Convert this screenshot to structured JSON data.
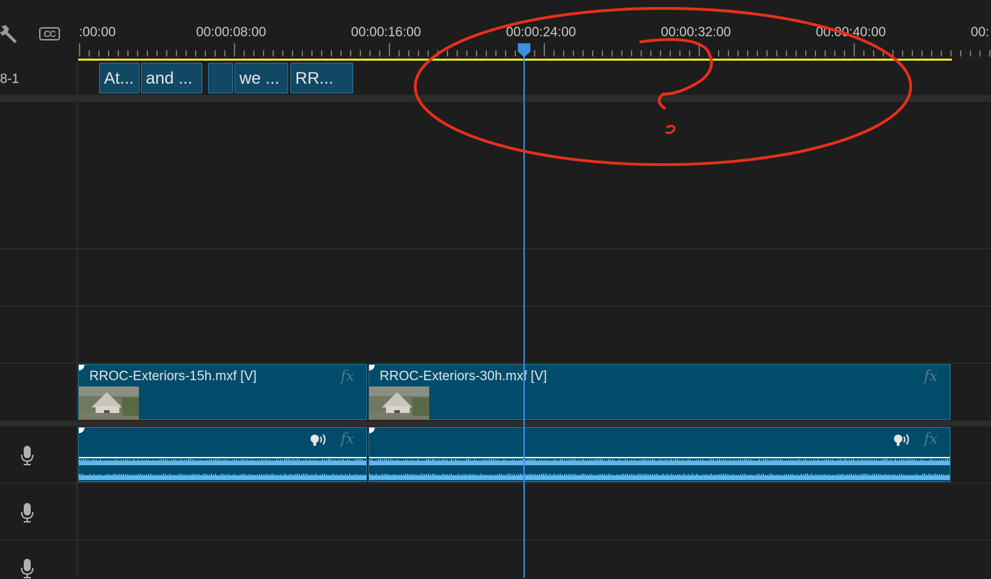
{
  "header": {
    "cc_label": "CC",
    "wrench_icon": "wrench-icon",
    "timecodes": [
      ":00:00",
      "00:00:08:00",
      "00:00:16:00",
      "00:00:24:00",
      "00:00:32:00",
      "00:00:40:00",
      "00:"
    ]
  },
  "caption_track": {
    "label": "8-1",
    "clips": [
      "At...",
      "and ...",
      "",
      "we ...",
      "RR..."
    ]
  },
  "video_track": {
    "clips": [
      {
        "name": "RROC-Exteriors-15h.mxf [V]",
        "fx": "fx"
      },
      {
        "name": "RROC-Exteriors-30h.mxf [V]",
        "fx": "fx"
      }
    ]
  },
  "audio_track": {
    "clips": [
      {
        "fx": "fx",
        "icon": "voice-icon"
      },
      {
        "fx": "fx",
        "icon": "voice-icon"
      }
    ]
  },
  "colors": {
    "clip_fill": "#004c6a",
    "work_area": "#f0e22a",
    "playhead": "#3d8de0",
    "annotation": "#e8301a"
  }
}
